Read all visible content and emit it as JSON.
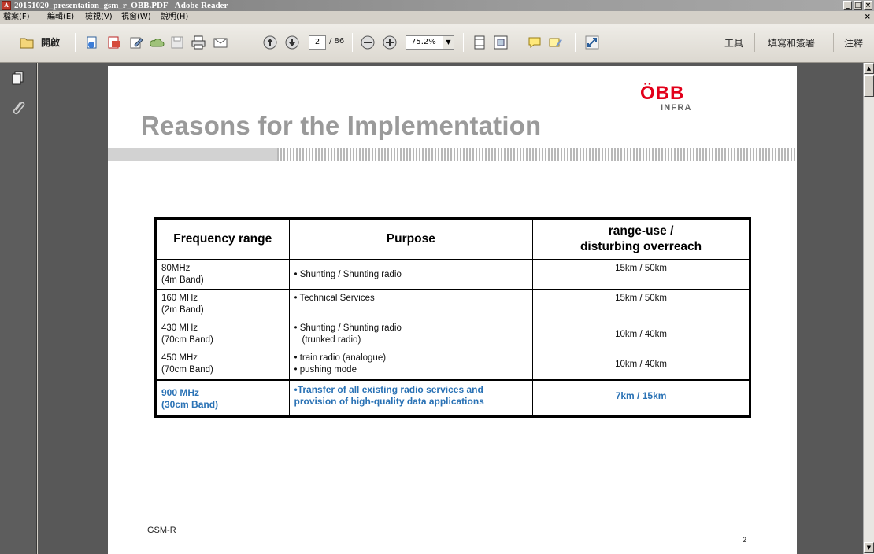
{
  "window": {
    "title": "20151020_presentation_gsm_r_OBB.PDF - Adobe Reader",
    "controls": [
      "_",
      "□",
      "×"
    ]
  },
  "menubar": {
    "items": [
      "檔案(F)",
      "編輯(E)",
      "檢視(V)",
      "視窗(W)",
      "說明(H)"
    ],
    "close_doc": "×"
  },
  "toolbar": {
    "open_label": "開啟",
    "current_page": "2",
    "page_total": "/ 86",
    "zoom": "75.2%",
    "tools_label": "工具",
    "sign_label": "填寫和簽署",
    "comment_label": "注釋"
  },
  "slide": {
    "title": "Reasons for the Implementation",
    "logo_main": "ÖBB",
    "logo_sub": "INFRA",
    "footer": "GSM-R",
    "page_number": "2",
    "table": {
      "headers": [
        "Frequency range",
        "Purpose",
        "range-use /\ndisturbing overreach"
      ],
      "header_range": "range-use /",
      "header_overreach": "disturbing overreach",
      "rows": [
        {
          "freq": "80MHz",
          "band": "(4m Band)",
          "purpose": [
            "• Shunting / Shunting radio"
          ],
          "range": "15km / 50km"
        },
        {
          "freq": "160 MHz",
          "band": "(2m Band)",
          "purpose": [
            "• Technical Services"
          ],
          "range": "15km / 50km"
        },
        {
          "freq": "430 MHz",
          "band": "(70cm Band)",
          "purpose": [
            "• Shunting / Shunting radio",
            "(trunked radio)"
          ],
          "range": "10km /  40km"
        },
        {
          "freq": "450 MHz",
          "band": "(70cm Band)",
          "purpose": [
            "• train radio (analogue)",
            "• pushing mode"
          ],
          "range": "10km / 40km"
        },
        {
          "freq": "900 MHz",
          "band": "(30cm Band)",
          "purpose": [
            "•Transfer of all existing radio services and",
            "provision of high-quality data applications"
          ],
          "range": "7km / 15km"
        }
      ]
    }
  },
  "colors": {
    "highlight": "#2a72b5",
    "title_gray": "#9a9a9a",
    "logo_red": "#e2001a"
  }
}
